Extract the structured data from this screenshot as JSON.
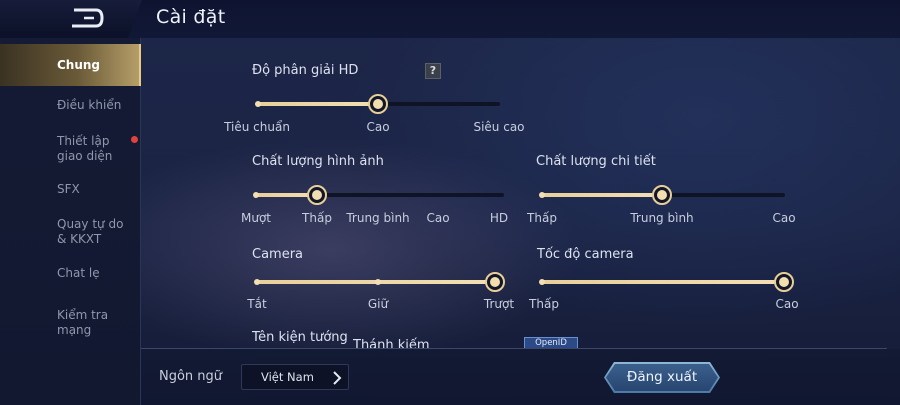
{
  "header": {
    "title": "Cài đặt"
  },
  "sidebar": {
    "items": [
      {
        "label": "Chung",
        "active": true
      },
      {
        "label": "Điều khiển"
      },
      {
        "label": "Thiết lập giao diện",
        "notification_dot": true
      },
      {
        "label": "SFX"
      },
      {
        "label": "Quay tự do & KKXT"
      },
      {
        "label": "Chat lẹ"
      },
      {
        "label": "Kiểm tra mạng"
      }
    ]
  },
  "settings": {
    "resolution": {
      "label": "Độ phân giải HD",
      "help": "?",
      "options": [
        "Tiêu chuẩn",
        "Cao",
        "Siêu cao"
      ],
      "selected_index": 1
    },
    "image_quality": {
      "label": "Chất lượng hình ảnh",
      "options": [
        "Mượt",
        "Thấp",
        "Trung bình",
        "Cao",
        "HD"
      ],
      "selected_index": 1
    },
    "detail_quality": {
      "label": "Chất lượng chi tiết",
      "options": [
        "Thấp",
        "Trung bình",
        "Cao"
      ],
      "selected_index": 1
    },
    "camera": {
      "label": "Camera",
      "options": [
        "Tắt",
        "Giữ",
        "Trượt"
      ],
      "selected_index": 2
    },
    "camera_speed": {
      "label": "Tốc độ camera",
      "min_label": "Thấp",
      "max_label": "Cao",
      "value_fraction": 1.0
    },
    "hero_name": {
      "label": "Tên kiện tướng",
      "value": "Thánh kiếm",
      "badge": "OpenID"
    }
  },
  "footer": {
    "language_label": "Ngôn ngữ",
    "language_value": "Việt Nam",
    "logout_label": "Đăng xuất"
  },
  "colors": {
    "accent_gold": "#e8cf9a",
    "background": "#1b2445",
    "notification": "#e0413c",
    "button_blue": "#2e4f7c"
  }
}
